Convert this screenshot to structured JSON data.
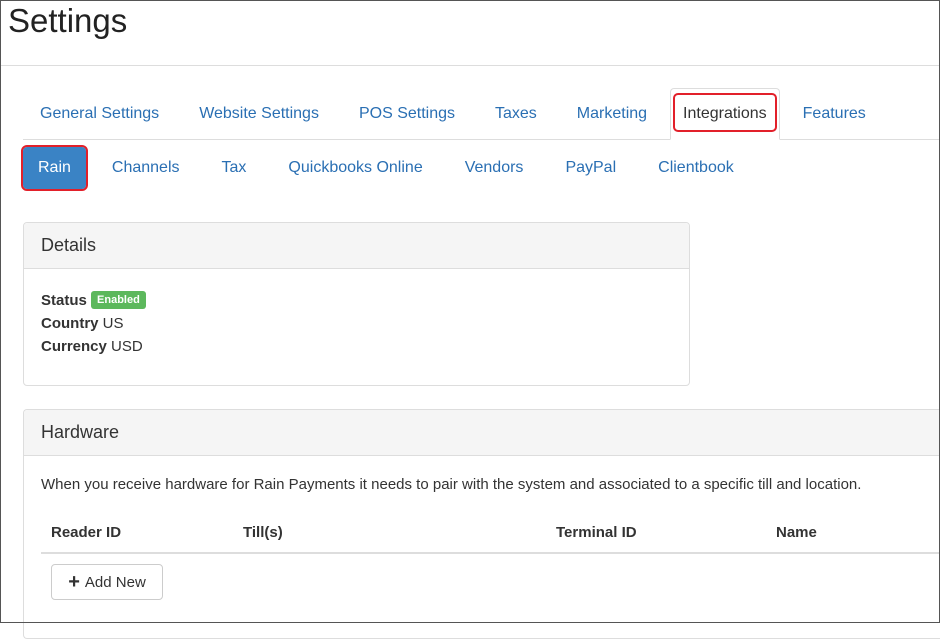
{
  "page": {
    "title": "Settings"
  },
  "tabs": [
    {
      "label": "General Settings"
    },
    {
      "label": "Website Settings"
    },
    {
      "label": "POS Settings"
    },
    {
      "label": "Taxes"
    },
    {
      "label": "Marketing"
    },
    {
      "label": "Integrations",
      "active": true
    },
    {
      "label": "Features"
    }
  ],
  "subtabs": [
    {
      "label": "Rain",
      "active": true
    },
    {
      "label": "Channels"
    },
    {
      "label": "Tax"
    },
    {
      "label": "Quickbooks Online"
    },
    {
      "label": "Vendors"
    },
    {
      "label": "PayPal"
    },
    {
      "label": "Clientbook"
    }
  ],
  "details": {
    "heading": "Details",
    "status_label": "Status",
    "status_badge": "Enabled",
    "country_label": "Country",
    "country_value": "US",
    "currency_label": "Currency",
    "currency_value": "USD"
  },
  "hardware": {
    "heading": "Hardware",
    "description": "When you receive hardware for Rain Payments it needs to pair with the system and associated to a specific till and location.",
    "columns": [
      "Reader ID",
      "Till(s)",
      "Terminal ID",
      "Name"
    ],
    "add_button": "Add New"
  },
  "colors": {
    "link": "#2a6fb3",
    "active_pill": "#3a83c5",
    "highlight": "#e2202a",
    "badge": "#5cb85c"
  }
}
